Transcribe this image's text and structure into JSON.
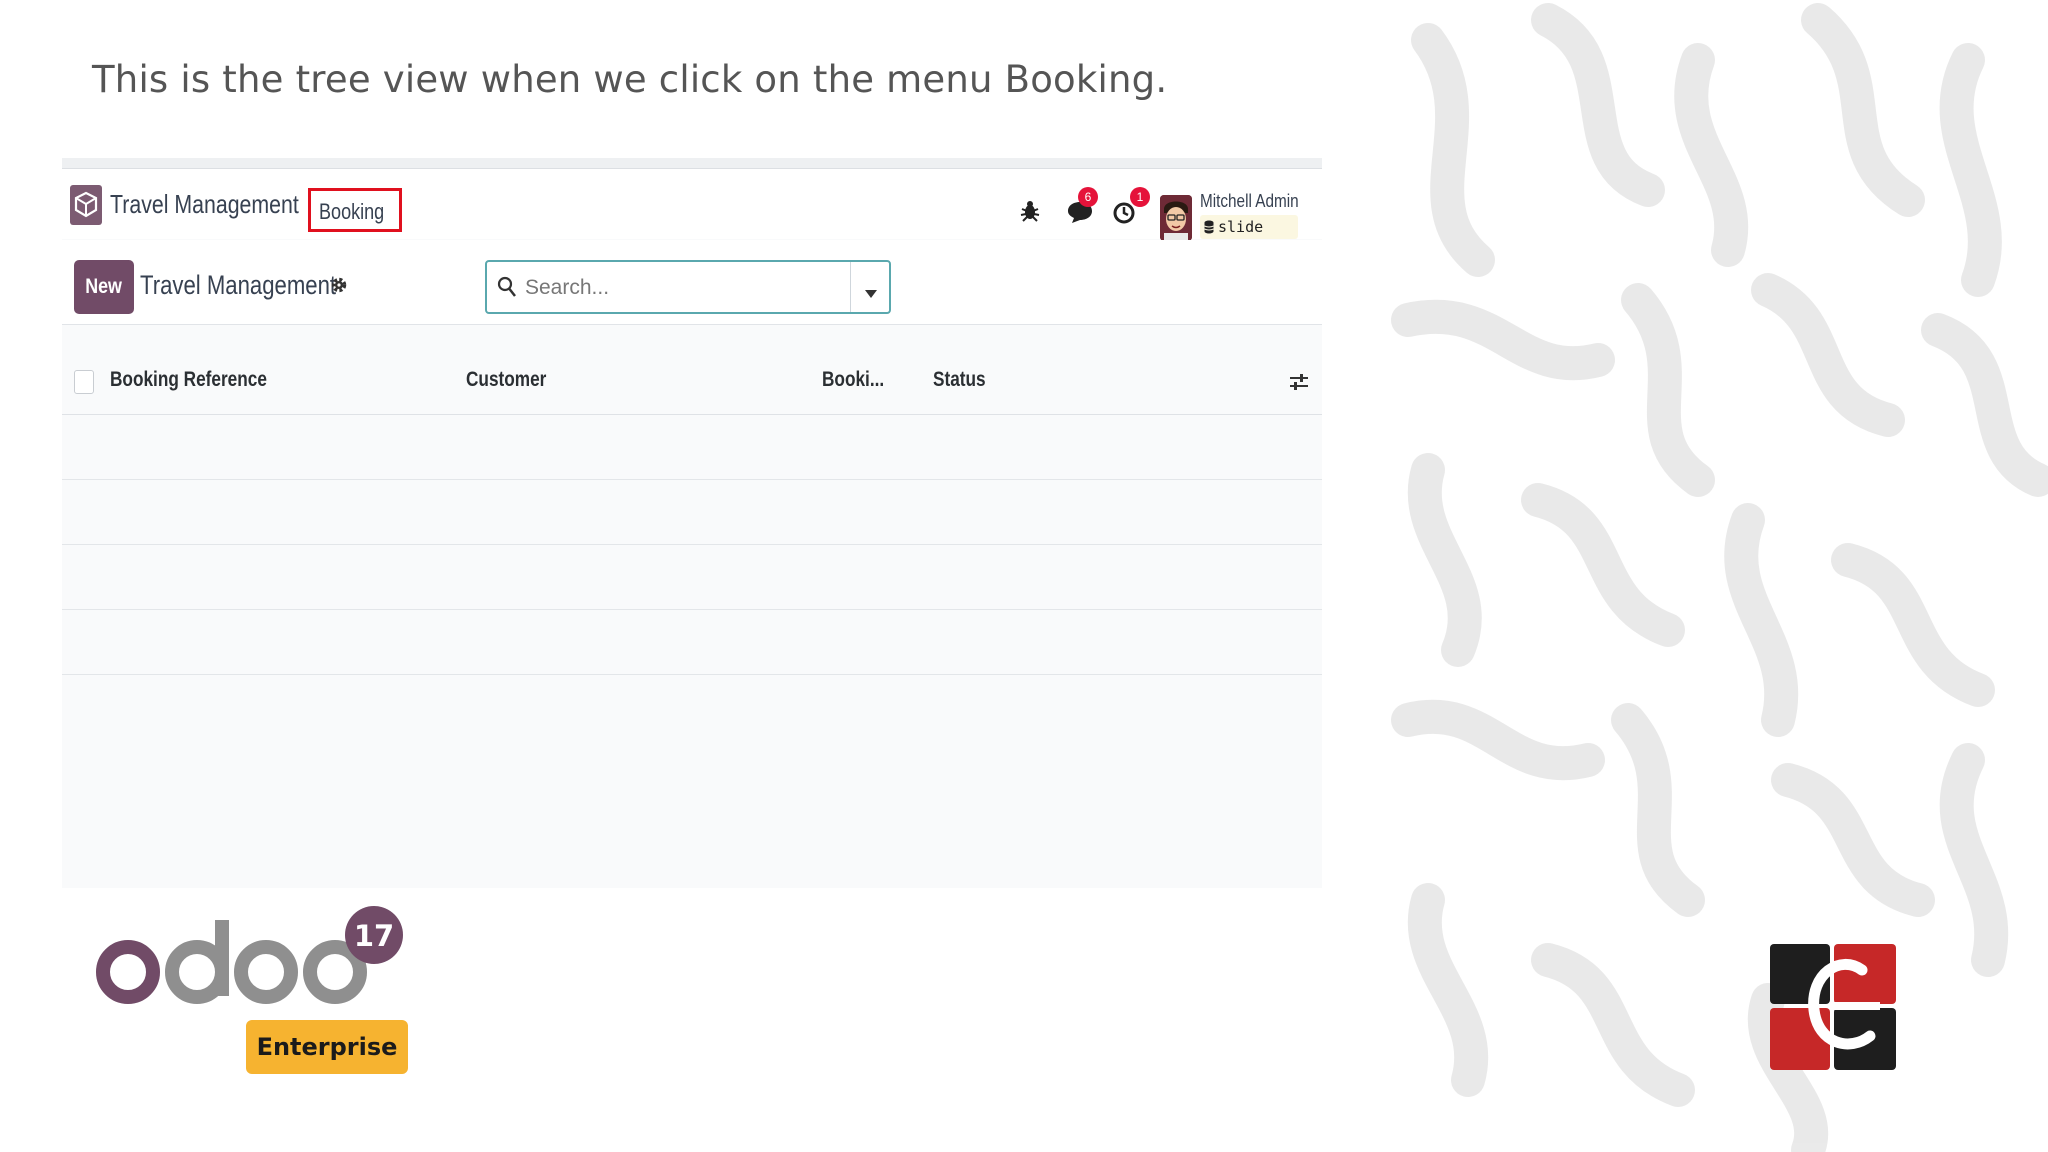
{
  "caption": "This is the tree view when we click on the menu Booking.",
  "navbar": {
    "app_name": "Travel Management",
    "menu_item": "Booking",
    "messages_badge": "6",
    "activities_badge": "1",
    "user_name": "Mitchell Admin",
    "database": "slide"
  },
  "control": {
    "new_label": "New",
    "breadcrumb": "Travel Management",
    "search_placeholder": "Search..."
  },
  "list": {
    "columns": [
      "Booking Reference",
      "Customer",
      "Booki...",
      "Status"
    ],
    "rows": []
  },
  "branding": {
    "version": "17",
    "edition": "Enterprise"
  },
  "colors": {
    "odoo_purple": "#714b67",
    "highlight_red": "#e0101e",
    "enterprise_yellow": "#f6b330",
    "badge_red": "#e5133a"
  }
}
